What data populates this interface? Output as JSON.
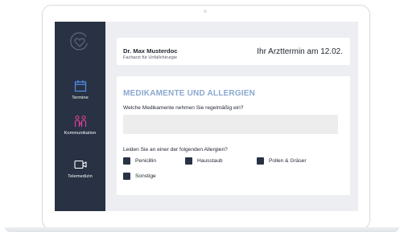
{
  "sidebar": {
    "logo": "heart-in-circle-logo",
    "items": [
      {
        "label": "Termine",
        "icon": "calendar-icon"
      },
      {
        "label": "Kommunikation",
        "icon": "people-icon"
      },
      {
        "label": "Telemedizin",
        "icon": "video-camera-icon"
      }
    ]
  },
  "header": {
    "doctor_name": "Dr. Max Musterdoc",
    "doctor_title": "Facharzt für Unfallchirurgie",
    "appointment": "Ihr Arzttermin am 12.02."
  },
  "form": {
    "section_title": "MEDIKAMENTE UND ALLERGIEN",
    "medication_question": "Welche Medikamente nehmen Sie regelmäßig ein?",
    "medication_value": "",
    "allergy_question": "Leiden Sie an einer der folgenden Allergien?",
    "allergies": [
      {
        "label": "Penicillin"
      },
      {
        "label": "Hausstaub"
      },
      {
        "label": "Pollen & Gräser"
      },
      {
        "label": "Sonstige"
      }
    ]
  },
  "colors": {
    "sidebar_bg": "#283244",
    "accent_pink": "#e6409c",
    "accent_blue": "#4f8fea",
    "section_title": "#8aa8cf",
    "screen_bg": "#eceef1",
    "checkbox": "#283244"
  }
}
